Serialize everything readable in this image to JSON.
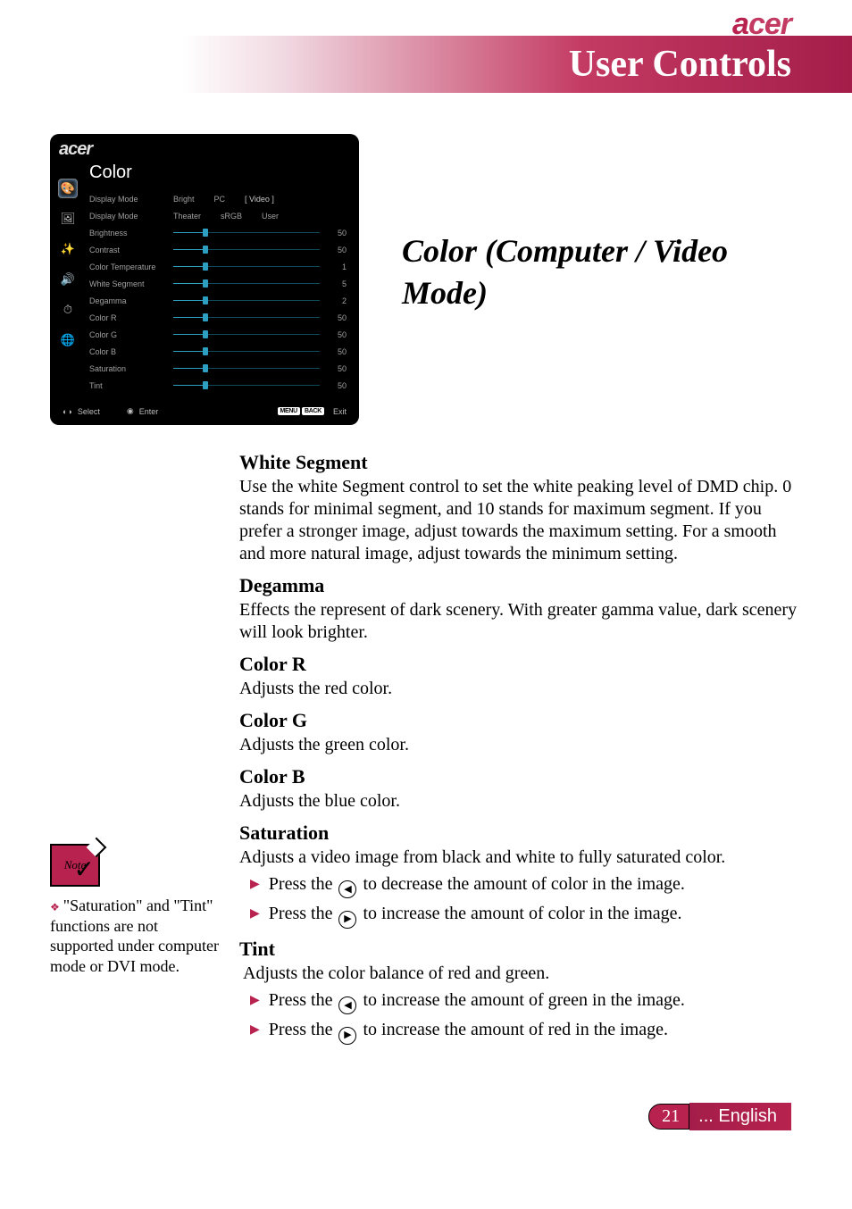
{
  "brand": "acer",
  "page_title": "User Controls",
  "section_title": "Color (Computer / Video Mode)",
  "osd": {
    "brand": "acer",
    "title": "Color",
    "mode_row1": {
      "label": "Display Mode",
      "opts": [
        "Bright",
        "PC",
        "[  Video  ]"
      ]
    },
    "mode_row2": {
      "label": "Display Mode",
      "opts": [
        "Theater",
        "sRGB",
        "User"
      ]
    },
    "sliders": [
      {
        "label": "Brightness",
        "value": "50"
      },
      {
        "label": "Contrast",
        "value": "50"
      },
      {
        "label": "Color Temperature",
        "value": "1"
      },
      {
        "label": "White Segment",
        "value": "5"
      },
      {
        "label": "Degamma",
        "value": "2"
      },
      {
        "label": "Color R",
        "value": "50"
      },
      {
        "label": "Color G",
        "value": "50"
      },
      {
        "label": "Color B",
        "value": "50"
      },
      {
        "label": "Saturation",
        "value": "50"
      },
      {
        "label": "Tint",
        "value": "50"
      }
    ],
    "footer": {
      "select": "Select",
      "enter": "Enter",
      "menu": "MENU",
      "back": "BACK",
      "exit": "Exit"
    }
  },
  "sections": {
    "ws_h": "White Segment",
    "ws_p": "Use the white Segment control to set the white peaking level of DMD chip. 0 stands for minimal segment, and 10 stands for maximum segment.  If you prefer a stronger image, adjust towards the maximum setting.  For a smooth and more natural image, adjust towards the minimum setting.",
    "dg_h": "Degamma",
    "dg_p": "Effects the represent of dark scenery.  With greater gamma value, dark scenery will look brighter.",
    "cr_h": "Color R",
    "cr_p": "Adjusts the red color.",
    "cg_h": "Color G",
    "cg_p": "Adjusts the green color.",
    "cb_h": "Color B",
    "cb_p": "Adjusts the blue color.",
    "sat_h": "Saturation",
    "sat_p": "Adjusts a video image from black and white to fully saturated color.",
    "sat_b1a": "Press the ",
    "sat_b1b": " to decrease the amount of color in the image.",
    "sat_b2a": "Press the ",
    "sat_b2b": " to increase the amount of color in the image.",
    "tint_h": "Tint",
    "tint_p": "Adjusts the color balance of red and green.",
    "tint_b1a": "Press the ",
    "tint_b1b": " to increase the amount of green in the image.",
    "tint_b2a": "Press the ",
    "tint_b2b": " to increase the amount of red  in the image."
  },
  "note": {
    "label": "Note",
    "text": "\"Saturation\" and \"Tint\" functions are not supported under computer mode or DVI mode."
  },
  "footer": {
    "page": "21",
    "lang": "... English"
  }
}
